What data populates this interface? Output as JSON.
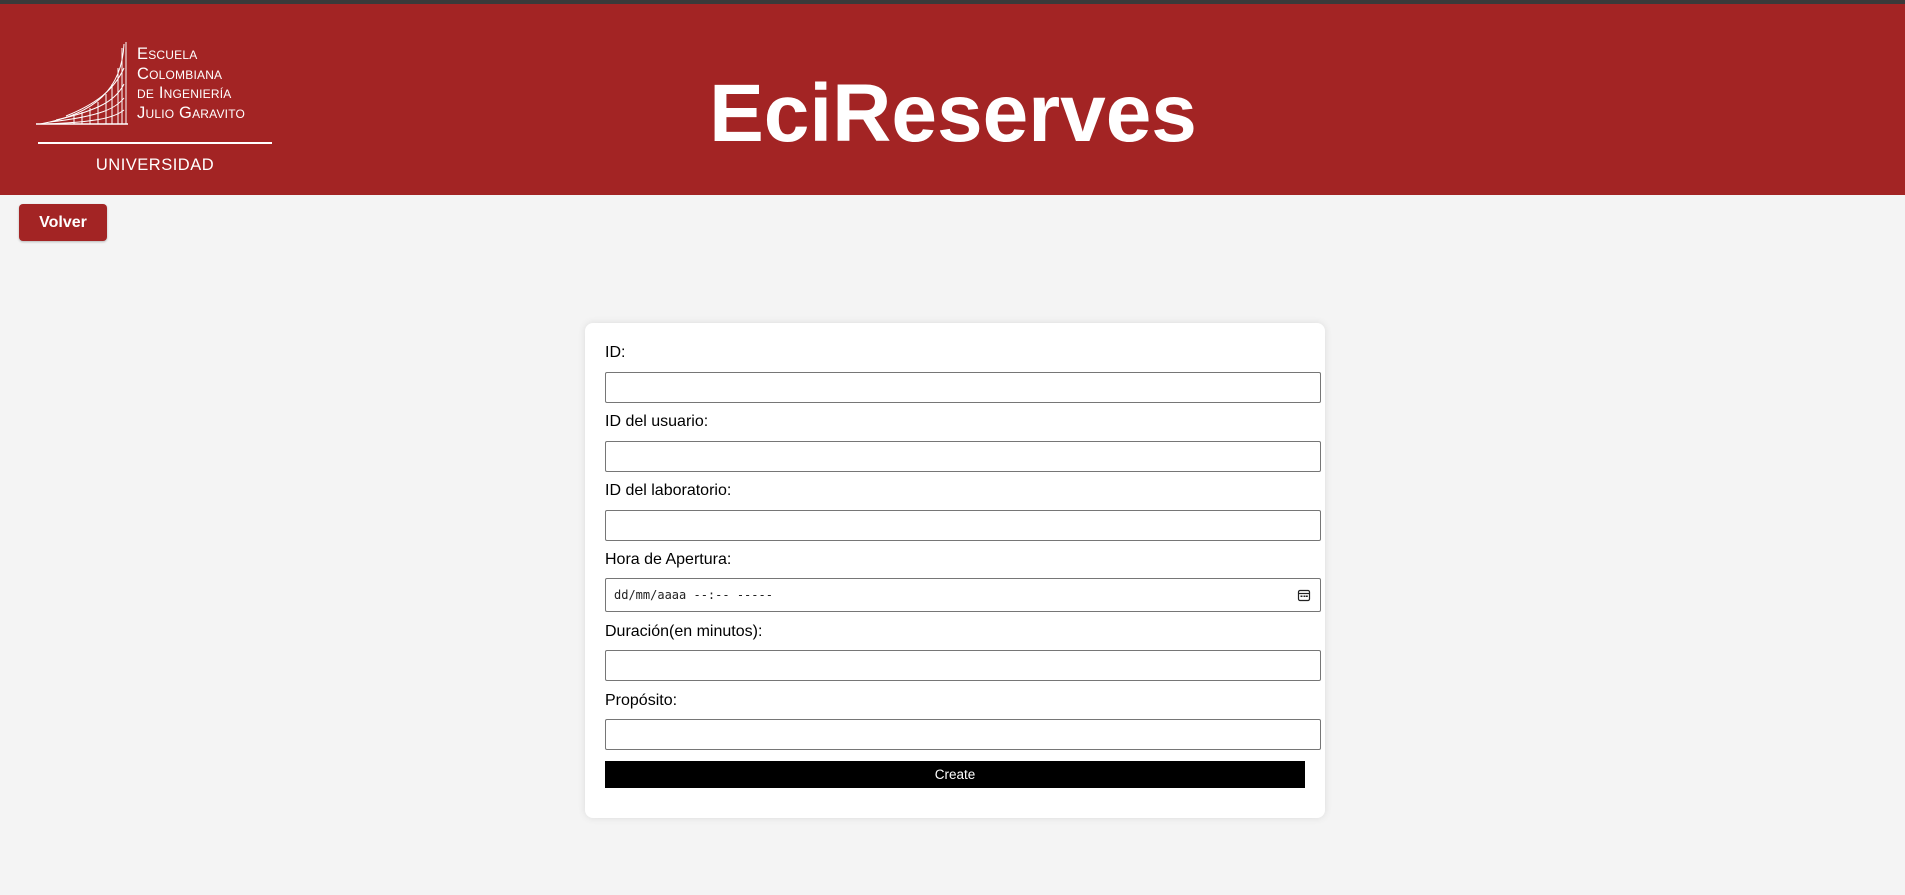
{
  "header": {
    "logo": {
      "lines": [
        "Escuela",
        "Colombiana",
        "de Ingeniería",
        "Julio Garavito"
      ],
      "subtitle": "UNIVERSIDAD"
    },
    "title": "EciReserves",
    "background_color": "#a32424"
  },
  "back_button": {
    "label": "Volver"
  },
  "form": {
    "fields": [
      {
        "label": "ID:",
        "value": ""
      },
      {
        "label": "ID del usuario:",
        "value": ""
      },
      {
        "label": "ID del laboratorio:",
        "value": ""
      },
      {
        "label": "Hora de Apertura:",
        "value": "",
        "placeholder": "dd/mm/aaaa --:-- -----",
        "icon": "calendar-icon"
      },
      {
        "label": "Duración(en minutos):",
        "value": ""
      },
      {
        "label": "Propósito:",
        "value": ""
      }
    ],
    "submit_label": "Create"
  }
}
